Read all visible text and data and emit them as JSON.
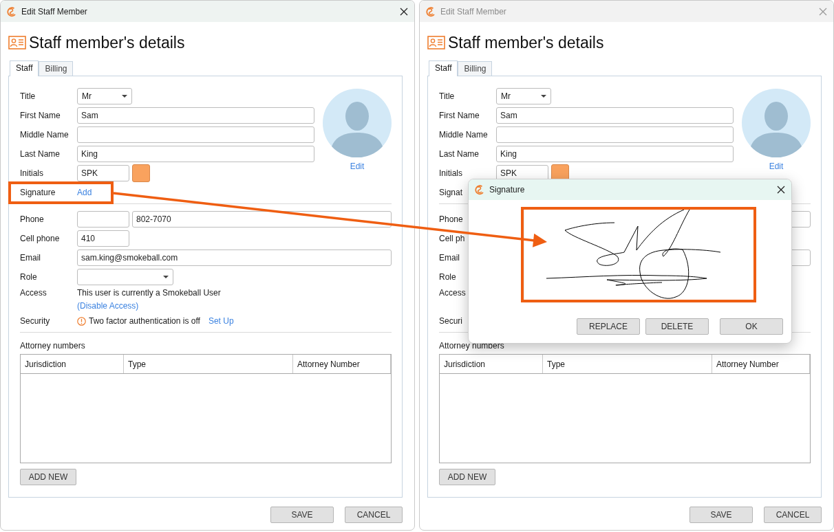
{
  "windows": [
    {
      "title": "Edit Staff Member",
      "active": true,
      "heading": "Staff member's details",
      "tabs": [
        {
          "label": "Staff",
          "selected": true
        },
        {
          "label": "Billing",
          "selected": false
        }
      ],
      "avatar_link": "Edit",
      "profile_fields": [
        {
          "label": "Title",
          "controls": [
            {
              "kind": "short-select",
              "value": "Mr"
            }
          ]
        },
        {
          "label": "First Name",
          "controls": [
            {
              "kind": "input",
              "value": "Sam"
            }
          ]
        },
        {
          "label": "Middle Name",
          "controls": [
            {
              "kind": "input"
            }
          ]
        },
        {
          "label": "Last Name",
          "controls": [
            {
              "kind": "input",
              "value": "King"
            }
          ]
        },
        {
          "label": "Initials",
          "controls": [
            {
              "kind": "short-input",
              "value": "SPK"
            },
            {
              "kind": "color",
              "color": "#f9a25e"
            }
          ]
        }
      ],
      "signature_row": {
        "label": "Signature",
        "controls": [
          {
            "kind": "link",
            "text": "Add"
          }
        ]
      },
      "contact_fields": [
        {
          "label": "Phone",
          "controls": [
            {
              "kind": "short-input"
            },
            {
              "kind": "input",
              "value": "802-7070"
            }
          ]
        },
        {
          "label": "Cell phone",
          "controls": [
            {
              "kind": "short-input",
              "value": "410"
            }
          ]
        },
        {
          "label": "Email",
          "controls": [
            {
              "kind": "input",
              "value": "sam.king@smokeball.com"
            }
          ]
        },
        {
          "label": "Role",
          "controls": [
            {
              "kind": "select"
            }
          ]
        },
        {
          "label": "Access",
          "stacked": true,
          "controls": [
            {
              "kind": "text",
              "text": "This user is currently a Smokeball User"
            },
            {
              "kind": "link",
              "text": "(Disable Access)"
            }
          ]
        },
        {
          "label": "Security",
          "controls": [
            {
              "kind": "warning",
              "text": "Two factor authentication is off"
            },
            {
              "kind": "link",
              "text": "Set Up"
            }
          ]
        }
      ],
      "attorney_title": "Attorney numbers",
      "columns": [
        "Jurisdiction",
        "Type",
        "Attorney Number"
      ],
      "add_button": "ADD NEW",
      "buttons": [
        "SAVE",
        "CANCEL"
      ]
    },
    {
      "title": "Edit Staff Member",
      "active": false,
      "heading": "Staff member's details",
      "tabs": [
        {
          "label": "Staff",
          "selected": true
        },
        {
          "label": "Billing",
          "selected": false
        }
      ],
      "avatar_link": "Edit",
      "profile_fields": [
        {
          "label": "Title",
          "controls": [
            {
              "kind": "short-select",
              "value": "Mr"
            }
          ]
        },
        {
          "label": "First Name",
          "controls": [
            {
              "kind": "input",
              "value": "Sam"
            }
          ]
        },
        {
          "label": "Middle Name",
          "controls": [
            {
              "kind": "input"
            }
          ]
        },
        {
          "label": "Last Name",
          "controls": [
            {
              "kind": "input",
              "value": "King"
            }
          ]
        },
        {
          "label": "Initials",
          "controls": [
            {
              "kind": "short-input",
              "value": "SPK"
            },
            {
              "kind": "color",
              "color": "#f9a25e"
            }
          ]
        }
      ],
      "signature_row": {
        "label": "Signat"
      },
      "contact_fields": [
        {
          "label": "Phone",
          "controls": [
            {
              "kind": "input"
            }
          ]
        },
        {
          "label": "Cell ph"
        },
        {
          "label": "Email",
          "controls": [
            {
              "kind": "input"
            }
          ]
        },
        {
          "label": "Role"
        },
        {
          "label": "Access",
          "stacked": true
        },
        {
          "label": "Securi"
        }
      ],
      "attorney_title": "Attorney numbers",
      "columns": [
        "Jurisdiction",
        "Type",
        "Attorney Number"
      ],
      "add_button": "ADD NEW",
      "buttons": [
        "SAVE",
        "CANCEL"
      ]
    }
  ],
  "signature_dialog": {
    "title": "Signature",
    "buttons": [
      "REPLACE",
      "DELETE",
      "OK"
    ]
  }
}
